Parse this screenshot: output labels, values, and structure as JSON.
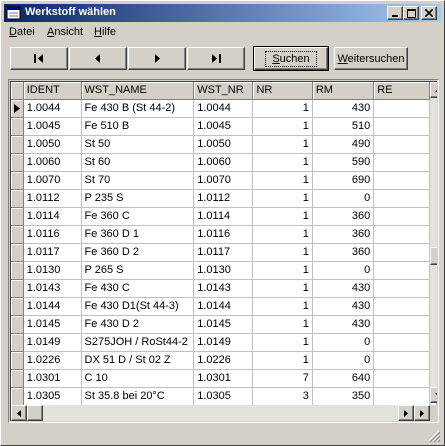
{
  "window": {
    "title": "Werkstoff wählen"
  },
  "menu": [
    {
      "label": "Datei",
      "underline": "D",
      "rest": "atei"
    },
    {
      "label": "Ansicht",
      "underline": "A",
      "rest": "nsicht"
    },
    {
      "label": "Hilfe",
      "underline": "H",
      "rest": "ilfe"
    }
  ],
  "toolbar": {
    "nav_buttons": [
      "first-record",
      "prior-record",
      "next-record",
      "last-record"
    ],
    "search_label": "Suchen",
    "search_underline": "S",
    "search_rest": "uchen",
    "continue_label": "Weitersuchen",
    "continue_underline": "W",
    "continue_rest": "eitersuchen"
  },
  "grid": {
    "columns": [
      "IDENT",
      "WST_NAME",
      "WST_NR",
      "NR",
      "RM",
      "RE"
    ],
    "current_row": 0,
    "rows": [
      [
        "1.0044",
        "Fe 430 B (St 44-2)",
        "1.0044",
        "1",
        "430",
        ""
      ],
      [
        "1.0045",
        "Fe 510 B",
        "1.0045",
        "1",
        "510",
        ""
      ],
      [
        "1.0050",
        "St 50",
        "1.0050",
        "1",
        "490",
        ""
      ],
      [
        "1.0060",
        "St 60",
        "1.0060",
        "1",
        "590",
        ""
      ],
      [
        "1.0070",
        "St 70",
        "1.0070",
        "1",
        "690",
        ""
      ],
      [
        "1.0112",
        "P 235 S",
        "1.0112",
        "1",
        "0",
        ""
      ],
      [
        "1.0114",
        "Fe 360 C",
        "1.0114",
        "1",
        "360",
        ""
      ],
      [
        "1.0116",
        "Fe 360 D 1",
        "1.0116",
        "1",
        "360",
        ""
      ],
      [
        "1.0117",
        "Fe 360 D 2",
        "1.0117",
        "1",
        "360",
        ""
      ],
      [
        "1.0130",
        "P 265 S",
        "1.0130",
        "1",
        "0",
        ""
      ],
      [
        "1.0143",
        "Fe 430 C",
        "1.0143",
        "1",
        "430",
        ""
      ],
      [
        "1.0144",
        "Fe 430 D1(St 44-3)",
        "1.0144",
        "1",
        "430",
        ""
      ],
      [
        "1.0145",
        "Fe 430 D 2",
        "1.0145",
        "1",
        "430",
        ""
      ],
      [
        "1.0149",
        "S275JOH / RoSt44-2",
        "1.0149",
        "1",
        "0",
        ""
      ],
      [
        "1.0226",
        "DX 51 D / St 02 Z",
        "1.0226",
        "1",
        "0",
        ""
      ],
      [
        "1.0301",
        "C 10",
        "1.0301",
        "7",
        "640",
        ""
      ],
      [
        "1.0305",
        "St 35.8 bei 20°C",
        "1.0305",
        "3",
        "350",
        ""
      ]
    ]
  },
  "scroll": {
    "vertical_position": 0.55
  }
}
